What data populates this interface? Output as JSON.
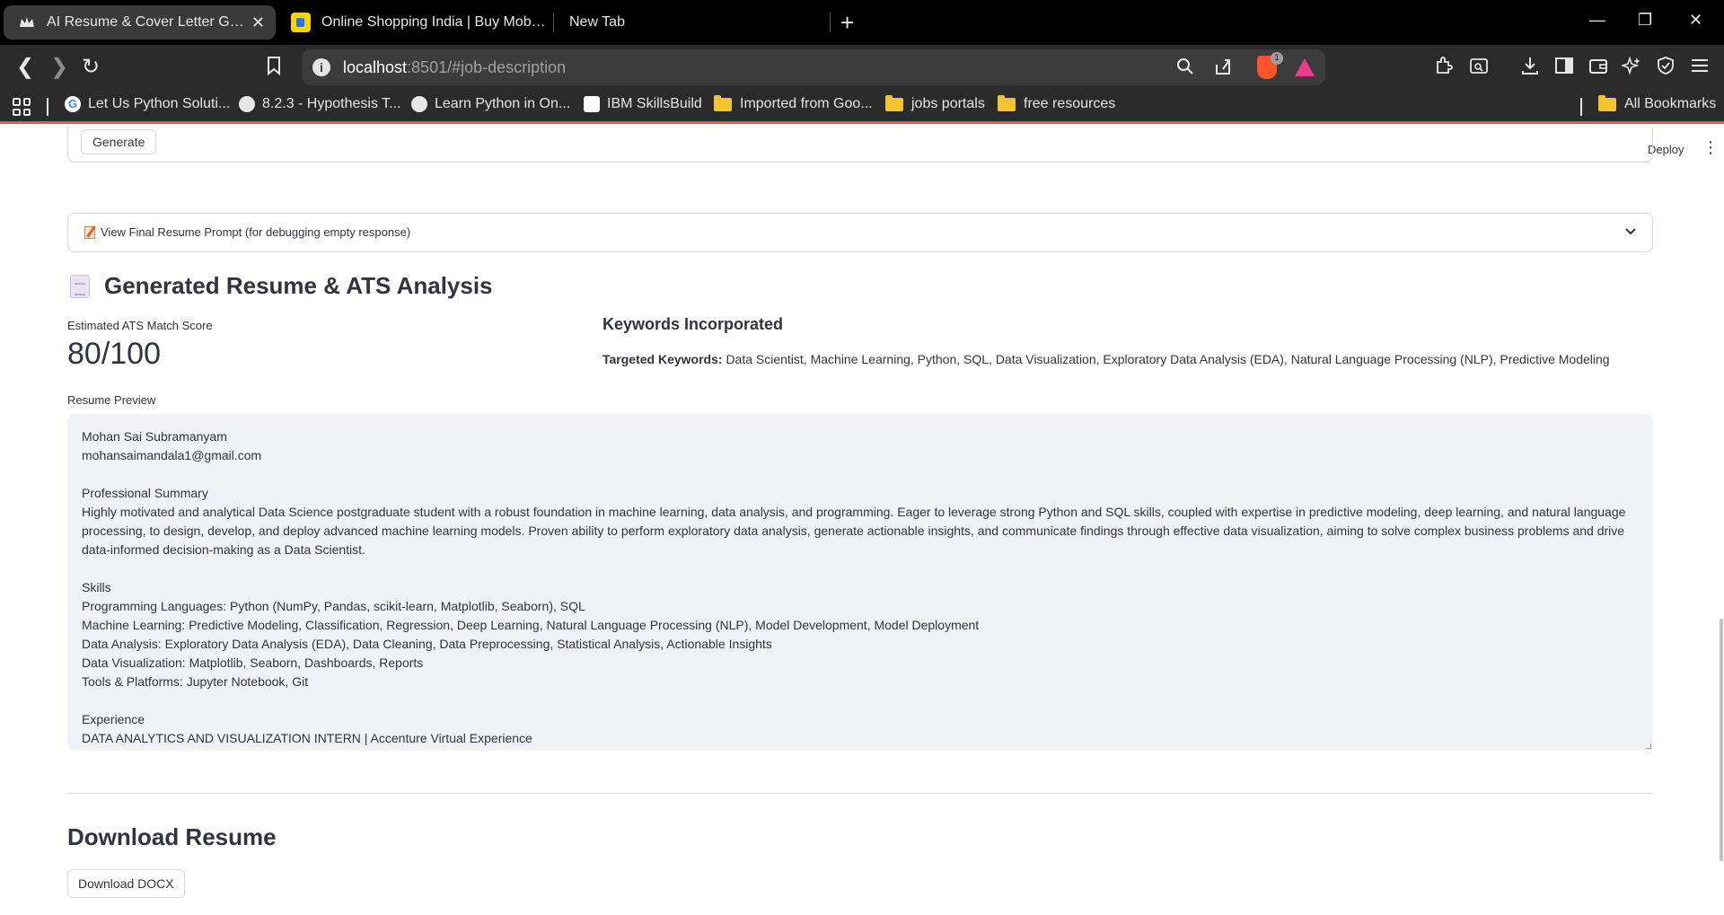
{
  "browser": {
    "tabs": [
      {
        "title": "AI Resume & Cover Letter Generator",
        "favicon": "streamlit-crown-icon",
        "active": true
      },
      {
        "title": "Online Shopping India | Buy Mobiles, Electronics",
        "favicon": "flipkart-icon",
        "active": false
      },
      {
        "title": "New Tab",
        "favicon": "",
        "active": false
      }
    ],
    "new_tab_symbol": "+",
    "window_controls": {
      "minimize": "—",
      "restore": "❐",
      "close": "✕"
    },
    "url_host": "localhost",
    "url_rest": ":8501/#job-description",
    "brave_badge_count": "1",
    "bookmarks": [
      {
        "label": "Let Us Python Soluti...",
        "icon": "google-icon"
      },
      {
        "label": "8.2.3 - Hypothesis T...",
        "icon": "globe-icon"
      },
      {
        "label": "Learn Python in On...",
        "icon": "globe-icon"
      },
      {
        "label": "IBM SkillsBuild",
        "icon": "ibm-icon"
      },
      {
        "label": "Imported from Goo...",
        "icon": "folder-icon"
      },
      {
        "label": "jobs portals",
        "icon": "folder-icon"
      },
      {
        "label": "free resources",
        "icon": "folder-icon"
      }
    ],
    "all_bookmarks_label": "All Bookmarks"
  },
  "app": {
    "deploy_label": "Deploy",
    "generate_button": "Generate",
    "expander_label": "View Final Resume Prompt (for debugging empty response)",
    "section_title": "Generated Resume & ATS Analysis",
    "ats": {
      "label": "Estimated ATS Match Score",
      "value": "80/100"
    },
    "keywords": {
      "title": "Keywords Incorporated",
      "prefix": "Targeted Keywords:",
      "list": "Data Scientist, Machine Learning, Python, SQL, Data Visualization, Exploratory Data Analysis (EDA), Natural Language Processing (NLP), Predictive Modeling"
    },
    "resume_preview_label": "Resume Preview",
    "resume_lines": [
      "Mohan Sai Subramanyam",
      "mohansaimandala1@gmail.com",
      "",
      "Professional Summary",
      "Highly motivated and analytical Data Science postgraduate student with a robust foundation in machine learning, data analysis, and programming. Eager to leverage strong Python and SQL skills, coupled with expertise in predictive modeling, deep learning, and natural language processing, to design, develop, and deploy advanced machine learning models. Proven ability to perform exploratory data analysis, generate actionable insights, and communicate findings through effective data visualization, aiming to solve complex business problems and drive data-informed decision-making as a Data Scientist.",
      "",
      "Skills",
      "Programming Languages: Python (NumPy, Pandas, scikit-learn, Matplotlib, Seaborn), SQL",
      "Machine Learning: Predictive Modeling, Classification, Regression, Deep Learning, Natural Language Processing (NLP), Model Development, Model Deployment",
      "Data Analysis: Exploratory Data Analysis (EDA), Data Cleaning, Data Preprocessing, Statistical Analysis, Actionable Insights",
      "Data Visualization: Matplotlib, Seaborn, Dashboards, Reports",
      "Tools & Platforms: Jupyter Notebook, Git",
      "",
      "Experience",
      "DATA ANALYTICS AND VISUALIZATION INTERN | Accenture Virtual Experience"
    ],
    "download_title": "Download Resume",
    "download_button": "Download DOCX"
  }
}
